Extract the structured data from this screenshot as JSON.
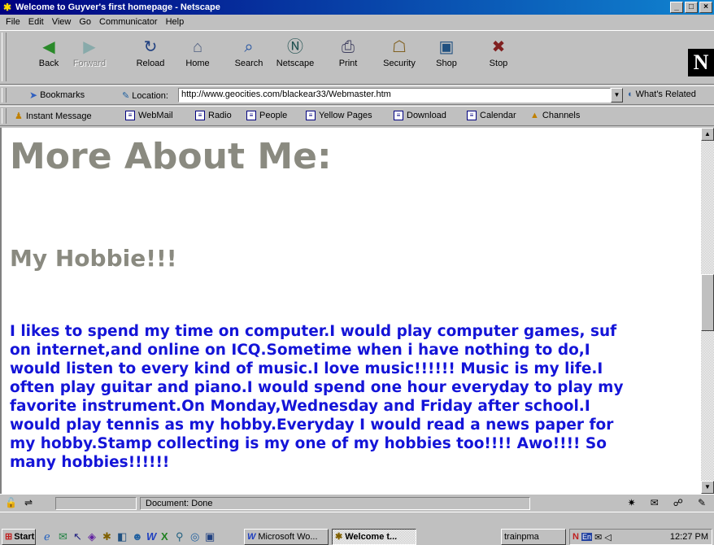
{
  "window": {
    "title": "Welcome to Guyver's first homepage - Netscape",
    "buttons": [
      "_",
      "□",
      "×"
    ]
  },
  "menu": [
    "File",
    "Edit",
    "View",
    "Go",
    "Communicator",
    "Help"
  ],
  "toolbar": [
    {
      "label": "Back",
      "icon": "back-arrow-icon",
      "glyph": "◀",
      "enabled": true
    },
    {
      "label": "Forward",
      "icon": "forward-arrow-icon",
      "glyph": "▶",
      "enabled": false
    },
    {
      "label": "Reload",
      "icon": "reload-icon",
      "glyph": "↻",
      "enabled": true
    },
    {
      "label": "Home",
      "icon": "home-icon",
      "glyph": "⌂",
      "enabled": true
    },
    {
      "label": "Search",
      "icon": "search-icon",
      "glyph": "⌕",
      "enabled": true
    },
    {
      "label": "Netscape",
      "icon": "netscape-icon",
      "glyph": "Ⓝ",
      "enabled": true
    },
    {
      "label": "Print",
      "icon": "print-icon",
      "glyph": "⎙",
      "enabled": true
    },
    {
      "label": "Security",
      "icon": "lock-icon",
      "glyph": "☖",
      "enabled": true
    },
    {
      "label": "Shop",
      "icon": "shop-icon",
      "glyph": "▣",
      "enabled": true
    },
    {
      "label": "Stop",
      "icon": "stop-icon",
      "glyph": "✖",
      "enabled": true
    }
  ],
  "location": {
    "bookmarks_label": "Bookmarks",
    "location_label": "Location:",
    "url": "http://www.geocities.com/blackear33/Webmaster.htm",
    "whats_related": "What's Related"
  },
  "personal_toolbar": [
    "Instant Message",
    "WebMail",
    "Radio",
    "People",
    "Yellow Pages",
    "Download",
    "Calendar",
    "Channels"
  ],
  "page": {
    "heading": "More About Me:",
    "subheading": "My Hobbie!!!",
    "paragraph_lines": [
      "I likes to spend my time on computer.I would play computer games, suf",
      "on internet,and online on ICQ.Sometime when i have nothing to do,I",
      "would listen to every kind of music.I love music!!!!!! Music is my life.I",
      "often play guitar and piano.I would spend one hour everyday to play my",
      "favorite instrument.On Monday,Wednesday and Friday after school.I",
      "would play tennis as my hobby.Everyday I would read a news paper for",
      "my hobby.Stamp collecting is my one of my hobbies too!!!! Awo!!!! So",
      "many hobbies!!!!!!"
    ],
    "colors": {
      "heading": "#8a8a80",
      "paragraph": "#1414d8"
    }
  },
  "status": {
    "text": "Document: Done"
  },
  "taskbar": {
    "start": "Start",
    "tasks": [
      {
        "label": "Microsoft Wo...",
        "active": false
      },
      {
        "label": "Welcome t...",
        "active": true
      },
      {
        "label": "trainpma",
        "active": false
      }
    ],
    "clock": "12:27 PM"
  }
}
